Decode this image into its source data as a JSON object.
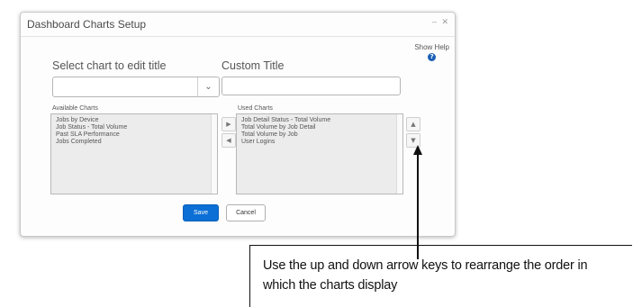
{
  "dialog": {
    "title": "Dashboard Charts Setup",
    "show_help": "Show Help",
    "help_icon": "?"
  },
  "select_chart": {
    "label": "Select chart to edit title",
    "value": ""
  },
  "custom_title": {
    "label": "Custom Title",
    "value": ""
  },
  "available_charts": {
    "label": "Available Charts",
    "items": [
      "Jobs by Device",
      "Job Status - Total Volume",
      "Past SLA Performance",
      "Jobs Completed"
    ]
  },
  "used_charts": {
    "label": "Used Charts",
    "items": [
      "Job Detail Status - Total Volume",
      "Total Volume by Job Detail",
      "Total Volume by Job",
      "User Logins"
    ]
  },
  "buttons": {
    "save": "Save",
    "cancel": "Cancel"
  },
  "callout": {
    "line1": "Use the up and down arrow keys to rearrange the order in",
    "line2": "which the charts display"
  }
}
